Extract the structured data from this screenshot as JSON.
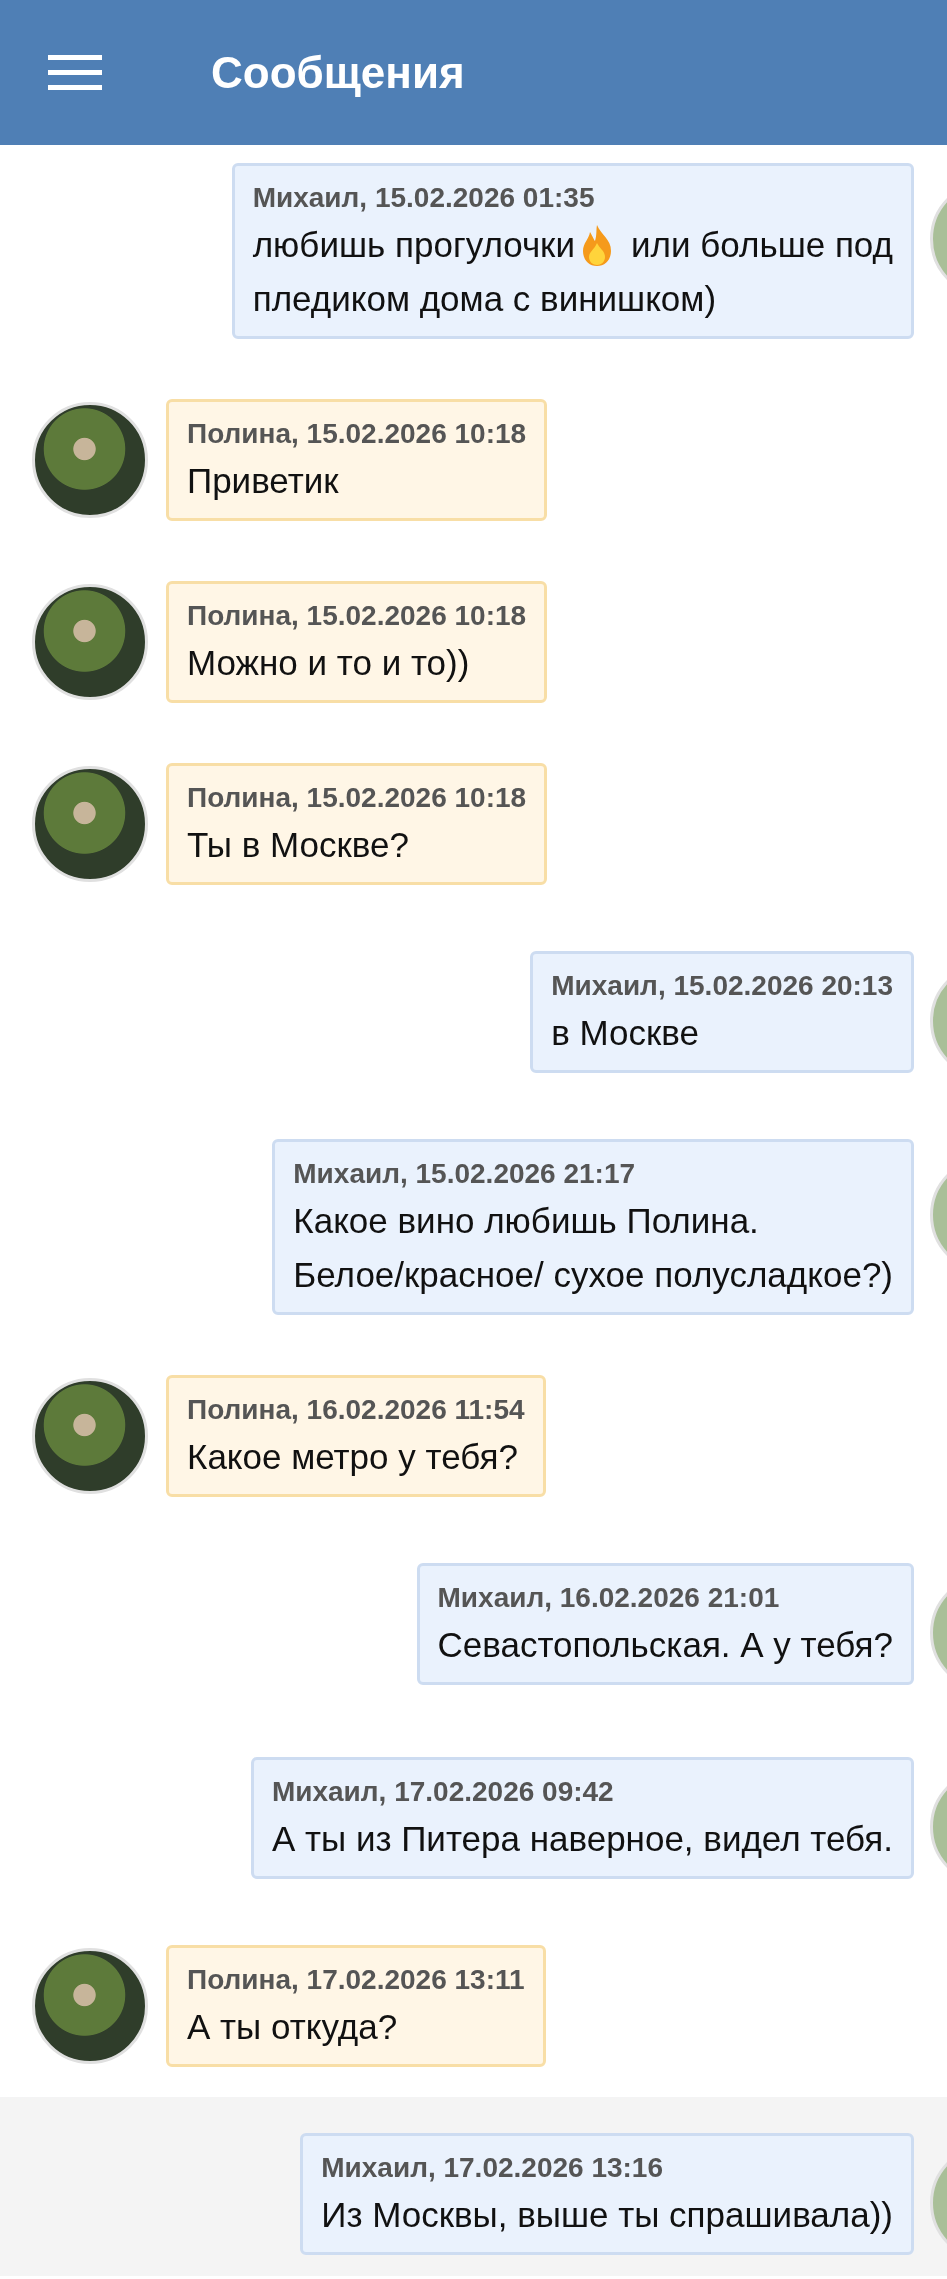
{
  "header": {
    "title": "Сообщения"
  },
  "messages": [
    {
      "kind": "outgoing",
      "meta": "Михаил, 15.02.2026 01:35",
      "highlighted": false,
      "lines": [
        [
          {
            "kind": "text",
            "text": "любишь прогулочки"
          },
          {
            "kind": "flame"
          },
          {
            "kind": "text",
            "text": "или больше под"
          }
        ],
        [
          {
            "kind": "text",
            "text": "пледиком дома с винишком)"
          }
        ]
      ]
    },
    {
      "kind": "incoming",
      "meta": "Полина, 15.02.2026 10:18",
      "highlighted": false,
      "lines": [
        [
          {
            "kind": "text",
            "text": "Приветик"
          }
        ]
      ]
    },
    {
      "kind": "incoming",
      "meta": "Полина, 15.02.2026 10:18",
      "highlighted": false,
      "lines": [
        [
          {
            "kind": "text",
            "text": "Можно и то и то))"
          }
        ]
      ]
    },
    {
      "kind": "incoming",
      "meta": "Полина, 15.02.2026 10:18",
      "highlighted": false,
      "lines": [
        [
          {
            "kind": "text",
            "text": "Ты в Москве?"
          }
        ]
      ]
    },
    {
      "kind": "outgoing",
      "meta": "Михаил, 15.02.2026 20:13",
      "highlighted": false,
      "lines": [
        [
          {
            "kind": "text",
            "text": "в Москве"
          }
        ]
      ]
    },
    {
      "kind": "outgoing",
      "meta": "Михаил, 15.02.2026 21:17",
      "highlighted": false,
      "lines": [
        [
          {
            "kind": "text",
            "text": "Какое вино любишь Полина."
          }
        ],
        [
          {
            "kind": "text",
            "text": "Белое/красное/ сухое полусладкое?)"
          }
        ]
      ]
    },
    {
      "kind": "incoming",
      "meta": "Полина, 16.02.2026 11:54",
      "highlighted": false,
      "lines": [
        [
          {
            "kind": "text",
            "text": "Какое метро у тебя?"
          }
        ]
      ]
    },
    {
      "kind": "outgoing",
      "meta": "Михаил, 16.02.2026 21:01",
      "highlighted": false,
      "lines": [
        [
          {
            "kind": "text",
            "text": "Севастопольская. А у тебя?"
          }
        ]
      ]
    },
    {
      "kind": "outgoing",
      "meta": "Михаил, 17.02.2026 09:42",
      "highlighted": false,
      "lines": [
        [
          {
            "kind": "text",
            "text": "А ты из Питера наверное, видел тебя."
          }
        ]
      ]
    },
    {
      "kind": "incoming",
      "meta": "Полина, 17.02.2026 13:11",
      "highlighted": false,
      "lines": [
        [
          {
            "kind": "text",
            "text": "А ты откуда?"
          }
        ]
      ]
    },
    {
      "kind": "outgoing",
      "meta": "Михаил, 17.02.2026 13:16",
      "highlighted": true,
      "lines": [
        [
          {
            "kind": "text",
            "text": "Из Москвы, выше ты спрашивала))"
          }
        ]
      ]
    }
  ]
}
